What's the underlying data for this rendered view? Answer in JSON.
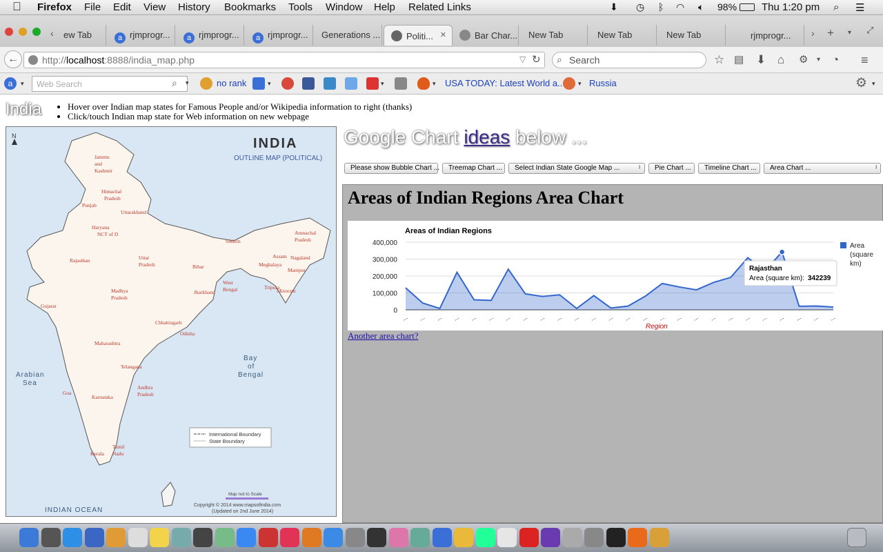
{
  "menubar": {
    "app": "Firefox",
    "items": [
      "File",
      "Edit",
      "View",
      "History",
      "Bookmarks",
      "Tools",
      "Window",
      "Help",
      "Related Links"
    ],
    "battery": "98%",
    "clock": "Thu 1:20 pm"
  },
  "tabs": [
    {
      "label": "ew Tab",
      "fav": ""
    },
    {
      "label": "rjmprogr...",
      "fav": "a"
    },
    {
      "label": "rjmprogr...",
      "fav": "a"
    },
    {
      "label": "rjmprogr...",
      "fav": "a"
    },
    {
      "label": "Generations ...",
      "fav": ""
    },
    {
      "label": "Politi...",
      "fav": "",
      "active": true
    },
    {
      "label": "Bar Char...",
      "fav": ""
    },
    {
      "label": "New Tab",
      "fav": ""
    },
    {
      "label": "New Tab",
      "fav": ""
    },
    {
      "label": "New Tab",
      "fav": ""
    },
    {
      "label": "rjmprogr...",
      "fav": ""
    }
  ],
  "nav": {
    "url_prefix": "http://",
    "url_host": "localhost",
    "url_rest": ":8888/india_map.php",
    "search_placeholder": "Search"
  },
  "toolbar2": {
    "web_search_placeholder": "Web Search",
    "no_rank": "no rank",
    "usa_today": "USA TODAY: Latest World a...",
    "russia": "Russia"
  },
  "page": {
    "india_title": "India",
    "instructions": [
      "Hover over Indian map states for Famous People and/or Wikipedia information to right (thanks)",
      "Click/touch Indian map state for Web information on new webpage"
    ],
    "map": {
      "title": "INDIA",
      "subtitle": "OUTLINE MAP (POLITICAL)",
      "north": "N",
      "legend": [
        "International Boundary",
        "State Boundary"
      ],
      "scale_note": "Map not to Scale",
      "copyright": "Copyright © 2014 www.mapsofindia.com",
      "updated": "(Updated on 2nd June 2014)",
      "seas": [
        "Arabian",
        "Sea",
        "Bay",
        "of",
        "Bengal",
        "INDIAN  OCEAN"
      ],
      "states": [
        "Jammu",
        "and",
        "Kashmir",
        "Himachal",
        "Pradesh",
        "Punjab",
        "Uttarakhand",
        "Haryana",
        "NCT of D",
        "Rajasthan",
        "Uttar",
        "Pradesh",
        "Bihar",
        "Sikkim",
        "Arunachal",
        "Pradesh",
        "Assam",
        "Nagaland",
        "Meghalaya",
        "Manipur",
        "Tripura",
        "Mizoram",
        "West",
        "Bengal",
        "Jharkhand",
        "Gujarat",
        "Madhya",
        "Pradesh",
        "Chhattisgarh",
        "Odisha",
        "Maharashtra",
        "Telangana",
        "Andhra",
        "Pradesh",
        "Goa",
        "Karnataka",
        "Kerala",
        "Tamil",
        "Nadu"
      ]
    },
    "google": {
      "title_pre": "Google Chart",
      "title_link": "ideas",
      "title_post": "below ..."
    },
    "selectors": [
      "Please show Bubble Chart ...",
      "Treemap Chart ...",
      "Select Indian State Google Map ...",
      "Pie Chart ...",
      "Timeline Chart ...",
      "Area Chart ..."
    ],
    "chart_heading": "Areas of Indian Regions Area Chart",
    "another_link": "Another area chart?",
    "tooltip": {
      "name": "Rajasthan",
      "label": "Area (square km): ",
      "value": "342239"
    },
    "accent": "#3366cc"
  },
  "chart_data": {
    "type": "area",
    "title": "Areas of Indian Regions",
    "xlabel": "Region",
    "ylabel": "",
    "legend": "Area (square km)",
    "legend_position": "right",
    "ylim": [
      0,
      400000
    ],
    "yticks": [
      "400,000",
      "300,000",
      "200,000",
      "100,000",
      "0"
    ],
    "xtick_label": "...",
    "series": [
      {
        "name": "Area (square km)",
        "values": [
          130000,
          40000,
          8000,
          222000,
          59000,
          55700,
          240000,
          94000,
          79000,
          88800,
          8200,
          84000,
          10500,
          22000,
          80000,
          155700,
          135000,
          118000,
          162000,
          191700,
          308000,
          230000,
          342239,
          21000,
          22300,
          16500
        ]
      }
    ],
    "highlight_index": 22,
    "grid": true
  },
  "dock_colors": [
    "#3b7ad6",
    "#555",
    "#2e8fe6",
    "#3a67c4",
    "#e09a36",
    "#ddd",
    "#f2d34a",
    "#7aa",
    "#444",
    "#7b8",
    "#3a89f2",
    "#c33",
    "#e03355",
    "#e07a22",
    "#3a8ae6",
    "#888",
    "#333",
    "#d7a",
    "#6a9",
    "#3a6fd8",
    "#e8b93a",
    "#2f9",
    "#e6e6e6",
    "#d22",
    "#6a3ab0",
    "#aaa",
    "#888",
    "#222",
    "#e86a1a",
    "#d9a03a"
  ]
}
